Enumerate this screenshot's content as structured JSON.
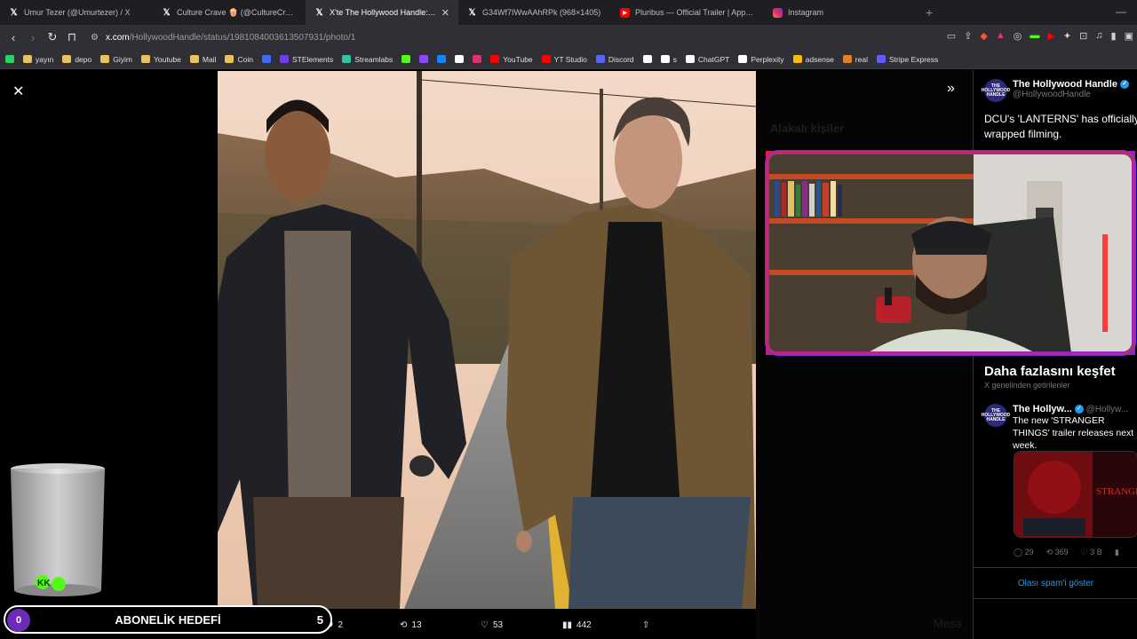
{
  "browser": {
    "tabs": [
      {
        "title": "Umur Tezer (@Umurtezer) / X",
        "icon": "x-icon",
        "active": false
      },
      {
        "title": "Culture Crave 🍿 (@CultureCrave) /",
        "icon": "x-icon",
        "active": false
      },
      {
        "title": "X'te The Hollywood Handle: \"DC",
        "icon": "x-icon",
        "active": true
      },
      {
        "title": "G34Wf7IWwAAhRPk (968×1405)",
        "icon": "x-icon",
        "active": false
      },
      {
        "title": "Pluribus — Official Trailer | Apple TV",
        "icon": "youtube-icon",
        "active": false
      },
      {
        "title": "Instagram",
        "icon": "instagram-icon",
        "active": false
      }
    ],
    "new_tab": "+",
    "url_host": "x.com",
    "url_path": "/HollywoodHandle/status/1981084003613507931/photo/1",
    "bookmarks": [
      {
        "label": "",
        "icon": "whatsapp-icon",
        "color": "#25d366"
      },
      {
        "label": "yayın",
        "icon": "folder-icon"
      },
      {
        "label": "depo",
        "icon": "folder-icon"
      },
      {
        "label": "Giyim",
        "icon": "folder-icon"
      },
      {
        "label": "Youtube",
        "icon": "folder-icon"
      },
      {
        "label": "Mail",
        "icon": "folder-icon"
      },
      {
        "label": "Coin",
        "icon": "folder-icon"
      },
      {
        "label": "",
        "icon": "r-icon",
        "color": "#3b6cf6"
      },
      {
        "label": "STElements",
        "icon": "st-icon",
        "color": "#6b3bf6"
      },
      {
        "label": "Streamlabs",
        "icon": "streamlabs-icon",
        "color": "#31c3a2"
      },
      {
        "label": "",
        "icon": "kick-icon",
        "color": "#53fc18"
      },
      {
        "label": "",
        "icon": "twitch-icon",
        "color": "#9146ff"
      },
      {
        "label": "",
        "icon": "bluesky-icon",
        "color": "#1185fe"
      },
      {
        "label": "",
        "icon": "x-icon",
        "color": "#ffffff"
      },
      {
        "label": "",
        "icon": "instagram-icon",
        "color": "#e1306c"
      },
      {
        "label": "YouTube",
        "icon": "youtube-icon",
        "color": "#ff0000"
      },
      {
        "label": "YT Studio",
        "icon": "yt-studio-icon",
        "color": "#ff0000"
      },
      {
        "label": "Discord",
        "icon": "discord-icon",
        "color": "#5865f2"
      },
      {
        "label": "",
        "icon": "tiktok-icon",
        "color": "#ffffff"
      },
      {
        "label": "s",
        "icon": "tiktok-icon",
        "color": "#ffffff"
      },
      {
        "label": "ChatGPT",
        "icon": "chatgpt-icon",
        "color": "#ffffff"
      },
      {
        "label": "Perplexity",
        "icon": "perplexity-icon",
        "color": "#ffffff"
      },
      {
        "label": "adsense",
        "icon": "adsense-icon",
        "color": "#fbbc04"
      },
      {
        "label": "real",
        "icon": "real-icon",
        "color": "#e67e22"
      },
      {
        "label": "Stripe Express",
        "icon": "stripe-icon",
        "color": "#635bff"
      }
    ]
  },
  "post": {
    "author_name": "The Hollywood Handle",
    "author_handle": "@HollywoodHandle",
    "avatar_text": "THE HOLLYWOOD HANDLE",
    "text": "DCU's 'LANTERNS' has officially wrapped filming.",
    "actions": {
      "reply": "2",
      "repost": "13",
      "like": "53",
      "views": "442"
    }
  },
  "explore": {
    "title": "Daha fazlasını keşfet",
    "subtitle": "X genelinden getirilenler",
    "post": {
      "author_name": "The Hollyw...",
      "author_handle": "@Hollyw...",
      "text": "The new 'STRANGER THINGS' trailer releases next week.",
      "thumb_text": "STRANGER THINGS",
      "replies": "29",
      "reposts": "369",
      "likes": "3 B"
    },
    "spam_link": "Olası spam'i göster"
  },
  "background_ghost": {
    "related": "Alakalı kişiler",
    "meta_word": "Mesa"
  },
  "overlay": {
    "goal_count": "0",
    "goal_title": "ABONELİK HEDEFİ",
    "goal_target": "5",
    "glass_letters": "KK"
  }
}
